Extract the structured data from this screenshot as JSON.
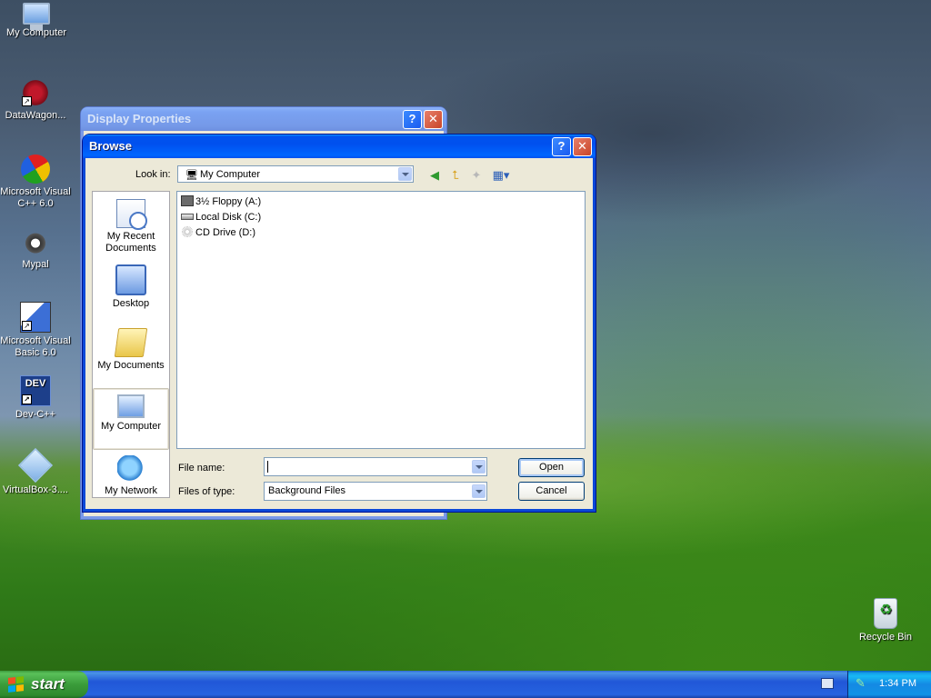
{
  "desktop": {
    "icons": [
      {
        "label": "My Computer",
        "icon": "my-computer-icon"
      },
      {
        "label": "DataWagon...",
        "icon": "datawagon-icon"
      },
      {
        "label": "Microsoft Visual C++ 6.0",
        "icon": "visual-cpp-icon"
      },
      {
        "label": "Mypal",
        "icon": "mypal-icon"
      },
      {
        "label": "Microsoft Visual Basic 6.0",
        "icon": "visual-basic-icon"
      },
      {
        "label": "Dev-C++",
        "icon": "dev-cpp-icon",
        "badge": "DEV"
      },
      {
        "label": "VirtualBox-3....",
        "icon": "virtualbox-icon"
      },
      {
        "label": "Recycle Bin",
        "icon": "recycle-bin-icon"
      }
    ]
  },
  "display_properties": {
    "title": "Display Properties",
    "help_glyph": "?",
    "close_glyph": "✕"
  },
  "browse": {
    "title": "Browse",
    "help_glyph": "?",
    "close_glyph": "✕",
    "look_in_label": "Look in:",
    "look_in_value": "My Computer",
    "toolbar": {
      "back_icon": "back-arrow-icon",
      "up_icon": "up-folder-icon",
      "new_folder_icon": "new-folder-icon",
      "views_icon": "views-menu-icon"
    },
    "places": [
      {
        "label": "My Recent Documents",
        "icon": "recent-documents-icon"
      },
      {
        "label": "Desktop",
        "icon": "desktop-icon"
      },
      {
        "label": "My Documents",
        "icon": "my-documents-icon"
      },
      {
        "label": "My Computer",
        "icon": "my-computer-icon",
        "selected": true
      },
      {
        "label": "My Network",
        "icon": "my-network-icon"
      }
    ],
    "files": [
      {
        "name": "3½ Floppy (A:)",
        "icon": "floppy-drive-icon"
      },
      {
        "name": "Local Disk (C:)",
        "icon": "local-disk-icon"
      },
      {
        "name": "CD Drive (D:)",
        "icon": "cd-drive-icon"
      }
    ],
    "file_name_label": "File name:",
    "file_name_value": "",
    "files_of_type_label": "Files of type:",
    "files_of_type_value": "Background Files",
    "open_label": "Open",
    "cancel_label": "Cancel"
  },
  "taskbar": {
    "start_label": "start",
    "clock": "1:34 PM"
  },
  "colors": {
    "xp_blue": "#0053ee",
    "start_green": "#3a9c3a",
    "dialog_face": "#ece9d8"
  }
}
